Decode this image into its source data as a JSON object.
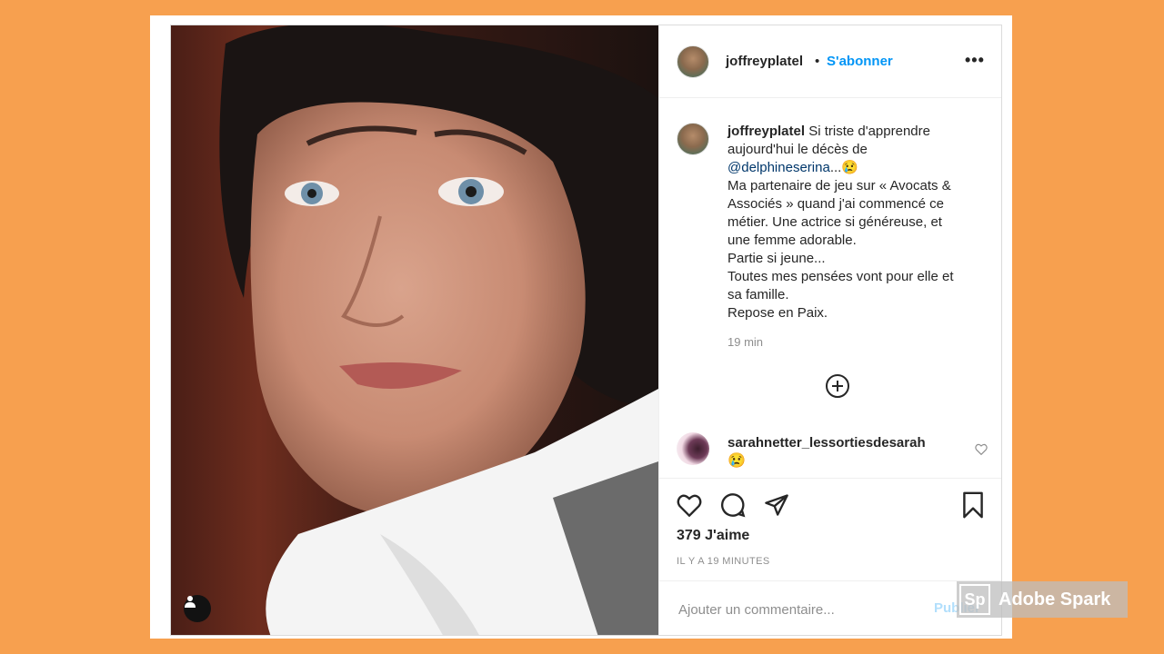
{
  "post": {
    "username": "joffreyplatel",
    "separator": "•",
    "follow_label": "S'abonner",
    "more_label": "•••",
    "caption": {
      "lines": [
        "Si triste d'apprendre",
        "aujourd'hui le décès de",
        "Ma partenaire de jeu sur « Avocats &",
        "Associés » quand j'ai commencé ce",
        "métier. Une actrice si généreuse, et",
        "une femme adorable.",
        "Partie si jeune...",
        "Toutes mes pensées vont pour elle et",
        "sa famille.",
        "Repose en Paix."
      ],
      "mention": "@delphineserina",
      "mention_suffix": "...😢"
    },
    "time_ago": "19 min",
    "comment": {
      "username": "sarahnetter_lessortiesdesarah",
      "text": "😢"
    },
    "likes_text": "379 J'aime",
    "timestamp": "IL Y A 19 MINUTES",
    "add_comment_placeholder": "Ajouter un commentaire...",
    "publish_label": "Publier"
  },
  "watermark": {
    "logo": "Sp",
    "text": "Adobe Spark"
  },
  "colors": {
    "background": "#f7a04f",
    "link_blue": "#0095f6",
    "mention_blue": "#00376b"
  },
  "icons": [
    "more-options-icon",
    "add-circle-icon",
    "heart-icon",
    "comment-icon",
    "share-icon",
    "bookmark-icon",
    "user-tag-icon"
  ]
}
